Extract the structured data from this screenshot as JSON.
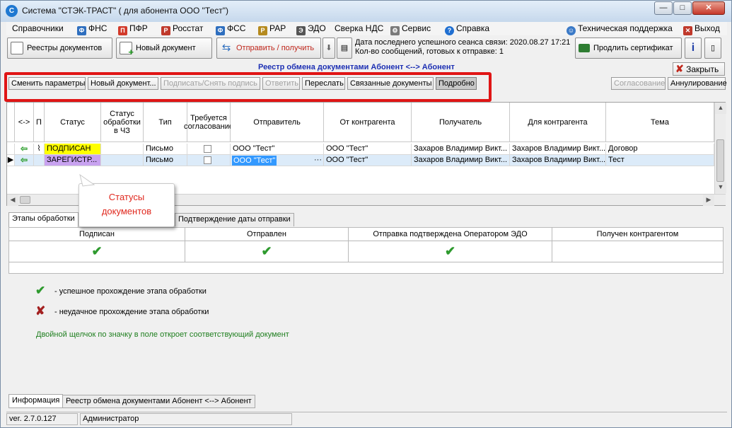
{
  "window": {
    "title": "Система \"СТЭК-ТРАСТ\" ( для абонента ООО \"Тест\")",
    "minimize": "—",
    "maximize": "□",
    "close": "✕"
  },
  "menu": {
    "items": [
      {
        "label": "Справочники",
        "icon": ""
      },
      {
        "label": "ФНС",
        "icon": "fns-icon",
        "color": "#2f6fbf"
      },
      {
        "label": "ПФР",
        "icon": "pfr-icon",
        "color": "#d23a2a"
      },
      {
        "label": "Росстат",
        "icon": "rosstat-icon",
        "color": "#c0392b"
      },
      {
        "label": "ФСС",
        "icon": "fss-icon",
        "color": "#2f6fbf"
      },
      {
        "label": "РАР",
        "icon": "rar-icon",
        "color": "#b58a1e"
      },
      {
        "label": "ЭДО",
        "icon": "edo-icon",
        "color": "#555555"
      },
      {
        "label": "Сверка НДС",
        "icon": ""
      },
      {
        "label": "Сервис",
        "icon": "gear-icon",
        "color": "#7a7a7a"
      },
      {
        "label": "Справка",
        "icon": "help-icon",
        "color": "#1f6fd1"
      },
      {
        "label": "Техническая поддержка",
        "icon": "support-icon",
        "color": "#3b7ac7"
      },
      {
        "label": "Выход",
        "icon": "exit-icon",
        "color": "#c0392b"
      }
    ]
  },
  "toolbar": {
    "registries_label": "Реестры документов",
    "new_document_label": "Новый документ",
    "send_receive_label": "Отправить / получить",
    "last_session_label": "Дата последнего успешного сеанса связи: 2020.08.27 17:21",
    "ready_count_label": "Кол-во сообщений, готовых к отправке: 1",
    "renew_cert_label": "Продлить сертификат",
    "info_icon_label": "i"
  },
  "registry": {
    "title": "Реестр обмена документами Абонент <--> Абонент",
    "close_label": "Закрыть",
    "buttons": {
      "change_params": "Сменить параметры",
      "new_document": "Новый документ...",
      "sign": "Подписать/Снять подпись",
      "reply": "Ответить",
      "forward": "Переслать",
      "related": "Связанные документы",
      "details": "Подробно",
      "approval": "Согласование",
      "annulment": "Аннулирование"
    }
  },
  "grid": {
    "columns": {
      "direction": "<->",
      "attachment": "П",
      "status": "Статус",
      "processing_status": "Статус обработки в ЧЗ",
      "type": "Тип",
      "approval_required": "Требуется согласование",
      "sender": "Отправитель",
      "from_counterparty": "От контрагента",
      "recipient": "Получатель",
      "for_counterparty": "Для контрагента",
      "subject": "Тема"
    },
    "rows": [
      {
        "status": "ПОДПИСАН",
        "status_color": "#ffff00",
        "type": "Письмо",
        "sender": "ООО \"Тест\"",
        "from_counterparty": "ООО \"Тест\"",
        "recipient": "Захаров Владимир Викт...",
        "for_counterparty": "Захаров Владимир Викт...",
        "subject": "Договор"
      },
      {
        "status": "ЗАРЕГИСТР...",
        "status_color": "#c8a2f0",
        "type": "Письмо",
        "sender": "ООО \"Тест\"",
        "from_counterparty": "ООО \"Тест\"",
        "recipient": "Захаров Владимир Викт...",
        "for_counterparty": "Захаров Владимир Викт...",
        "subject": "Тест"
      }
    ]
  },
  "callout": {
    "line1": "Статусы",
    "line2": "документов"
  },
  "stages_tabs": {
    "processing": "Этапы обработки",
    "send_date": "Подтверждение даты отправки"
  },
  "stages": [
    {
      "label": "Подписан",
      "mark": "✔"
    },
    {
      "label": "Отправлен",
      "mark": "✔"
    },
    {
      "label": "Отправка подтверждена Оператором ЭДО",
      "mark": "✔"
    },
    {
      "label": "Получен контрагентом",
      "mark": ""
    }
  ],
  "legend": {
    "success": "-  успешное прохождение этапа обработки",
    "failure": "-  неудачное прохождение этапа обработки",
    "hint": "Двойной щелчок по значку в поле откроет соответствующий документ",
    "success_mark": "✔",
    "failure_mark": "✘"
  },
  "bottom_tabs": {
    "info": "Информация",
    "registry": "Реестр обмена документами Абонент <--> Абонент"
  },
  "status_bar": {
    "version": "ver. 2.7.0.127",
    "user": "Администратор"
  }
}
